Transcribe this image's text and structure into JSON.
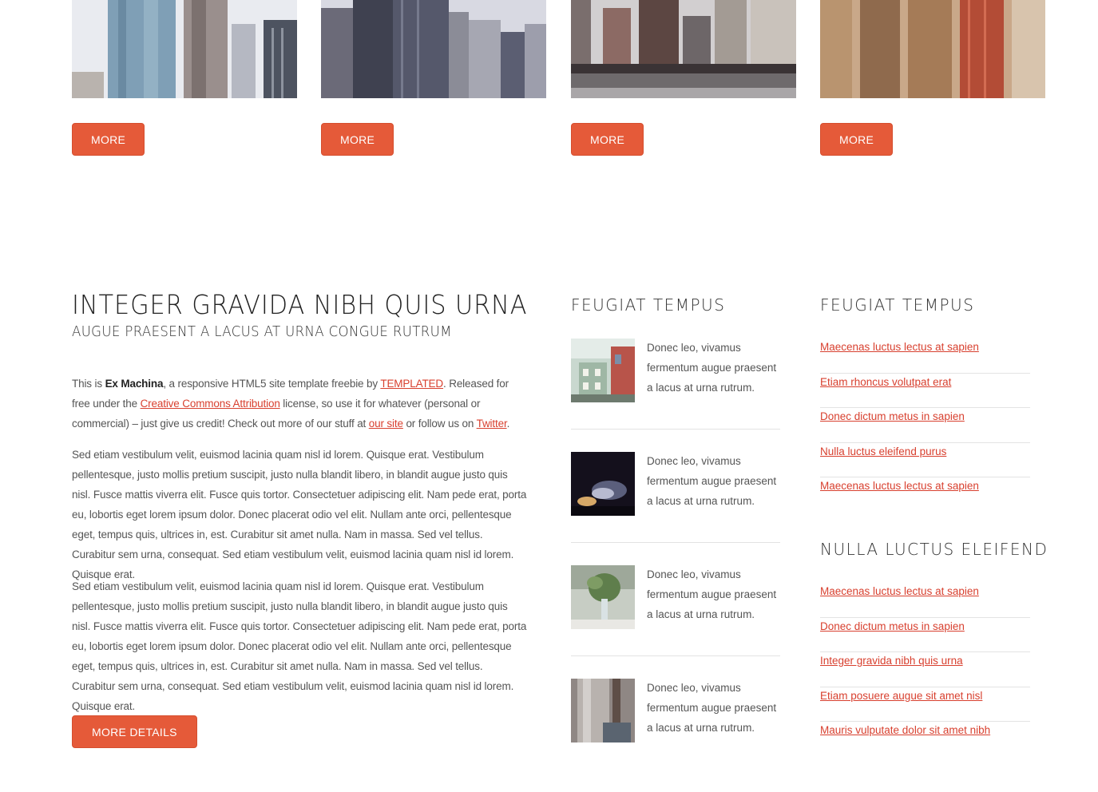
{
  "cards": [
    {
      "button_label": "MORE"
    },
    {
      "button_label": "MORE"
    },
    {
      "button_label": "MORE"
    },
    {
      "button_label": "MORE"
    }
  ],
  "main": {
    "title": "INTEGER GRAVIDA NIBH QUIS URNA",
    "subtitle": "AUGUE PRAESENT A LACUS AT URNA CONGUE RUTRUM",
    "intro": {
      "t1": "This is ",
      "brand": "Ex Machina",
      "t2": ", a responsive HTML5 site template freebie by ",
      "link_templated": "TEMPLATED",
      "t3": ". Released for free under the ",
      "link_cc": "Creative Commons Attribution",
      "t4": " license, so use it for whatever (personal or commercial) – just give us credit! Check out more of our stuff at ",
      "link_site": "our site",
      "t5": " or follow us on ",
      "link_twitter": "Twitter",
      "t6": "."
    },
    "paragraph_2": "Sed etiam vestibulum velit, euismod lacinia quam nisl id lorem. Quisque erat. Vestibulum pellentesque, justo mollis pretium suscipit, justo nulla blandit libero, in blandit augue justo quis nisl. Fusce mattis viverra elit. Fusce quis tortor. Consectetuer adipiscing elit. Nam pede erat, porta eu, lobortis eget lorem ipsum dolor. Donec placerat odio vel elit. Nullam ante orci, pellentesque eget, tempus quis, ultrices in, est. Curabitur sit amet nulla. Nam in massa. Sed vel tellus. Curabitur sem urna, consequat. Sed etiam vestibulum velit, euismod lacinia quam nisl id lorem. Quisque erat.",
    "paragraph_3": "Sed etiam vestibulum velit, euismod lacinia quam nisl id lorem. Quisque erat. Vestibulum pellentesque, justo mollis pretium suscipit, justo nulla blandit libero, in blandit augue justo quis nisl. Fusce mattis viverra elit. Fusce quis tortor. Consectetuer adipiscing elit. Nam pede erat, porta eu, lobortis eget lorem ipsum dolor. Donec placerat odio vel elit. Nullam ante orci, pellentesque eget, tempus quis, ultrices in, est. Curabitur sit amet nulla. Nam in massa. Sed vel tellus. Curabitur sem urna, consequat. Sed etiam vestibulum velit, euismod lacinia quam nisl id lorem. Quisque erat.",
    "more_details_label": "MORE DETAILS"
  },
  "middle": {
    "title": "FEUGIAT TEMPUS",
    "items": [
      {
        "text": "Donec leo, vivamus fermentum augue praesent a lacus at urna rutrum."
      },
      {
        "text": "Donec leo, vivamus fermentum augue praesent a lacus at urna rutrum."
      },
      {
        "text": "Donec leo, vivamus fermentum augue praesent a lacus at urna rutrum."
      },
      {
        "text": "Donec leo, vivamus fermentum augue praesent a lacus at urna rutrum."
      }
    ]
  },
  "right": {
    "section1": {
      "title": "FEUGIAT TEMPUS",
      "links": [
        "Maecenas luctus lectus at sapien",
        "Etiam rhoncus volutpat erat",
        "Donec dictum metus in sapien",
        "Nulla luctus eleifend purus",
        "Maecenas luctus lectus at sapien"
      ]
    },
    "section2": {
      "title": "NULLA LUCTUS ELEIFEND",
      "links": [
        "Maecenas luctus lectus at sapien",
        "Donec dictum metus in sapien",
        "Integer gravida nibh quis urna",
        "Etiam posuere augue sit amet nisl",
        "Mauris vulputate dolor sit amet nibh"
      ]
    }
  },
  "colors": {
    "accent": "#e55a39",
    "link": "#d8402f",
    "divider": "#e3e3e3"
  }
}
